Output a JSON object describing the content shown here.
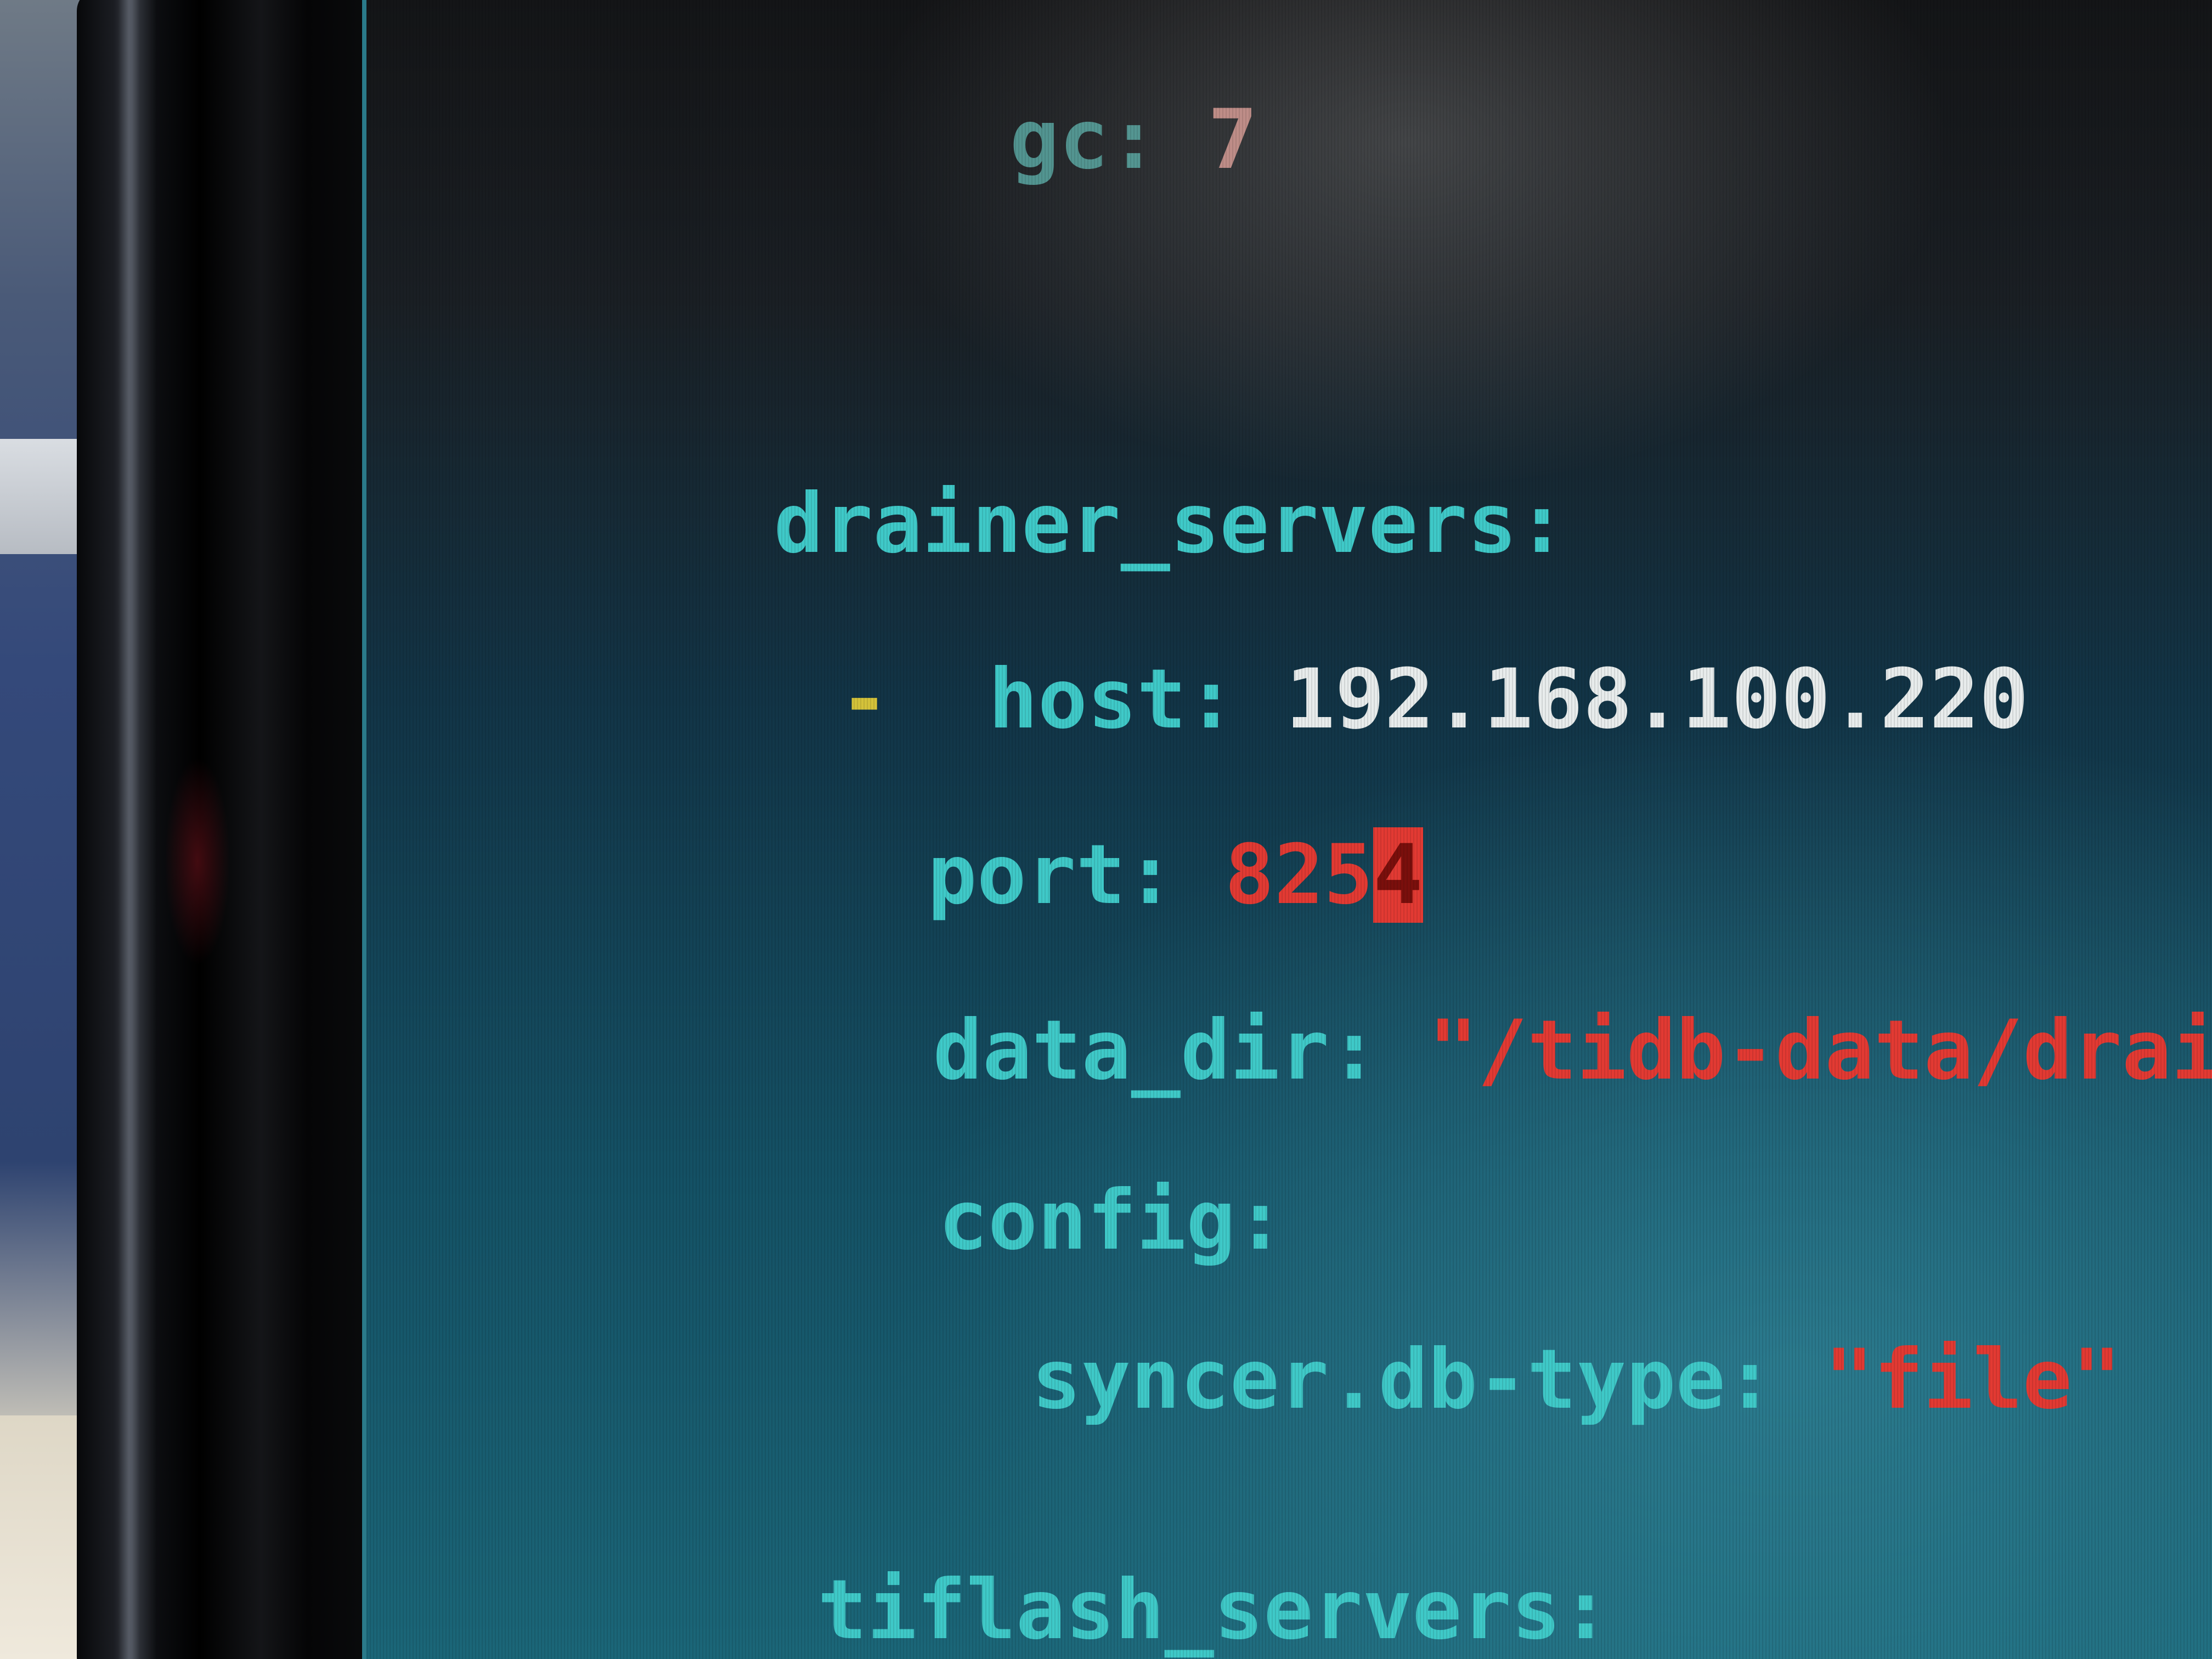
{
  "terminal": {
    "lines": {
      "gc": {
        "key": "gc:",
        "value": "7"
      },
      "drainer_servers": {
        "key": "drainer_servers:"
      },
      "host": {
        "dash": "-",
        "key": "host:",
        "value": "192.168.100.220"
      },
      "port": {
        "key": "port:",
        "value_prefix": "825",
        "value_cursor": "4"
      },
      "data_dir": {
        "key": "data_dir:",
        "value": "\"/tidb-data/drainer\""
      },
      "config": {
        "key": "config:"
      },
      "syncer_db_type": {
        "key": "syncer.db-type:",
        "value": "\"file\""
      },
      "tiflash_servers": {
        "key": "tiflash_servers:"
      }
    }
  },
  "colors": {
    "key": "#3fc9c8",
    "value_number": "#e23a33",
    "value_string": "#e23a33",
    "value_ip": "#e8ecec",
    "cursor": "#e23a33",
    "list_dash": "#d4c23a"
  }
}
